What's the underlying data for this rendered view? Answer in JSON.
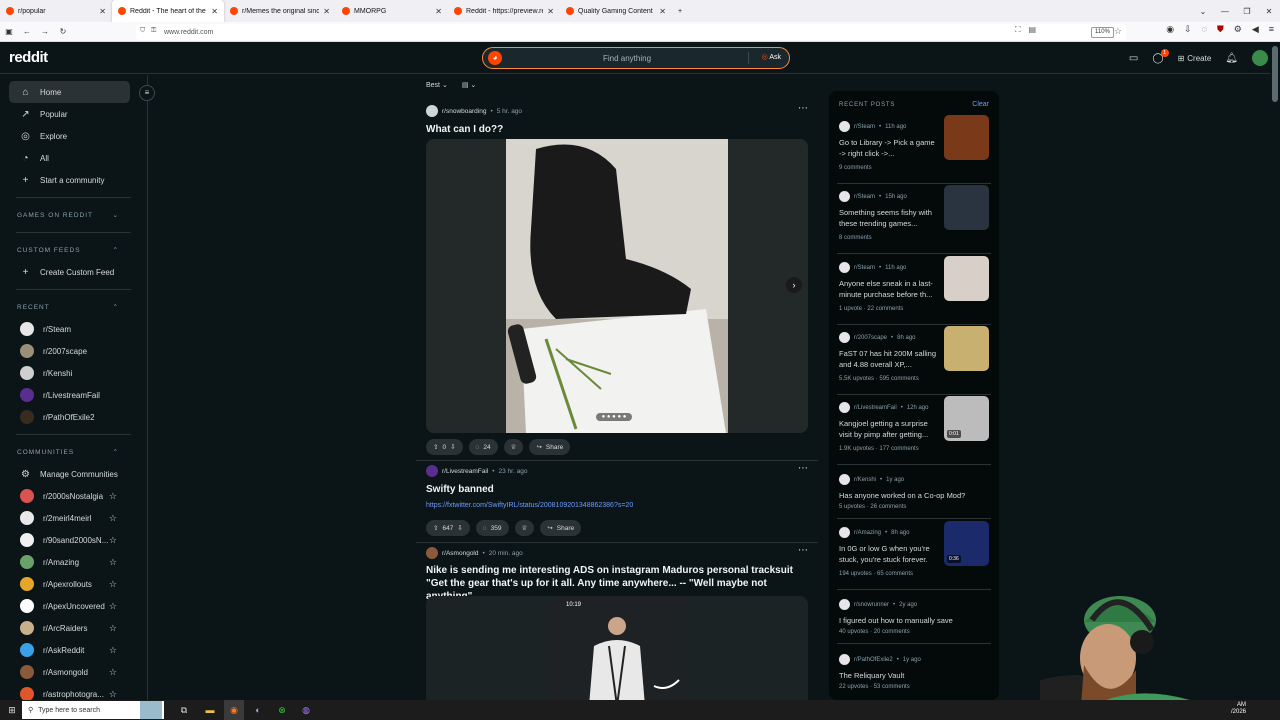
{
  "browser": {
    "tabs": [
      {
        "title": "r/popular",
        "active": false
      },
      {
        "title": "Reddit - The heart of the intern",
        "active": true
      },
      {
        "title": "r/Memes the original since 20",
        "active": false
      },
      {
        "title": "MMORPG",
        "active": false
      },
      {
        "title": "Reddit - https://preview.redd.it",
        "active": false
      },
      {
        "title": "Quality Gaming Content and Di",
        "active": false
      }
    ],
    "new_tab": "+",
    "url": "www.reddit.com",
    "zoom": "110%"
  },
  "header": {
    "logo": "reddit",
    "search_placeholder": "Find anything",
    "ask": "Ask",
    "create": "Create",
    "chat_badge": "1"
  },
  "sidebar": {
    "nav": [
      {
        "label": "Home",
        "icon": "home-icon",
        "active": true
      },
      {
        "label": "Popular",
        "icon": "popular-icon"
      },
      {
        "label": "Explore",
        "icon": "explore-icon"
      },
      {
        "label": "All",
        "icon": "all-icon"
      },
      {
        "label": "Start a community",
        "icon": "plus-icon"
      }
    ],
    "games_header": "GAMES ON REDDIT",
    "custom_feeds_header": "CUSTOM FEEDS",
    "create_custom_feed": "Create Custom Feed",
    "recent_header": "RECENT",
    "recent": [
      {
        "label": "r/Steam",
        "color": "#e6e6e6"
      },
      {
        "label": "r/2007scape",
        "color": "#9a8f77"
      },
      {
        "label": "r/Kenshi",
        "color": "#cfcfcf"
      },
      {
        "label": "r/LivestreamFail",
        "color": "#5a2d91"
      },
      {
        "label": "r/PathOfExile2",
        "color": "#3a2b20"
      }
    ],
    "communities_header": "COMMUNITIES",
    "manage": "Manage Communities",
    "communities": [
      {
        "label": "r/2000sNostalgia",
        "color": "#d9534f"
      },
      {
        "label": "r/2meirl4meirl",
        "color": "#e8e8e8"
      },
      {
        "label": "r/90sand2000sN...",
        "color": "#f0f0f0"
      },
      {
        "label": "r/Amazing",
        "color": "#6aa06a"
      },
      {
        "label": "r/Apexrollouts",
        "color": "#e4a52a"
      },
      {
        "label": "r/ApexUncovered",
        "color": "#ffffff"
      },
      {
        "label": "r/ArcRaiders",
        "color": "#c8b08a"
      },
      {
        "label": "r/AskReddit",
        "color": "#3aa0e8"
      },
      {
        "label": "r/Asmongold",
        "color": "#8a5a3a"
      },
      {
        "label": "r/astrophotogra...",
        "color": "#e0562a"
      }
    ]
  },
  "feed": {
    "sort": "Best",
    "posts": [
      {
        "sub": "r/snowboarding",
        "time": "5 hr. ago",
        "title": "What can I do??",
        "votes": "0",
        "comments": "24",
        "share": "Share"
      },
      {
        "sub": "r/LivestreamFail",
        "time": "23 hr. ago",
        "title": "Swifty banned",
        "link": "https://fxtwitter.com/SwiftyIRL/status/2008109201348862386?s=20",
        "votes": "647",
        "comments": "359",
        "share": "Share"
      },
      {
        "sub": "r/Asmongold",
        "time": "20 min. ago",
        "title": "Nike is sending me interesting ADS on instagram Maduros personal tracksuit \"Get the gear that's up for it all. Any time anywhere... -- \"Well maybe not anything\"",
        "phone_time": "10:19"
      }
    ]
  },
  "recent_posts": {
    "header": "RECENT POSTS",
    "clear": "Clear",
    "items": [
      {
        "sub": "r/Steam",
        "time": "11h ago",
        "title": "Go to Library -> Pick a game -> right click ->...",
        "stats": "9 comments",
        "thumb": "#7a3a1a"
      },
      {
        "sub": "r/Steam",
        "time": "15h ago",
        "title": "Something seems fishy with these trending games...",
        "stats": "8 comments",
        "thumb": "#2a3340"
      },
      {
        "sub": "r/Steam",
        "time": "11h ago",
        "title": "Anyone else sneak in a last-minute purchase before th...",
        "stats": "1 upvote · 22 comments",
        "thumb": "#d8d0c8"
      },
      {
        "sub": "r/2007scape",
        "time": "8h ago",
        "title": "FaST 07 has hit 200M salling and 4.88 overall XP,...",
        "stats": "5.5K upvotes · 595 comments",
        "thumb": "#c8b070"
      },
      {
        "sub": "r/LivestreamFail",
        "time": "12h ago",
        "title": "Kangjoel getting a surprise visit by pimp after getting...",
        "stats": "1.9K upvotes · 177 comments",
        "thumb": "#bcbcbc",
        "duration": "0:01"
      },
      {
        "sub": "r/Kenshi",
        "time": "1y ago",
        "title": "Has anyone worked on a Co-op Mod?",
        "stats": "5 upvotes · 26 comments"
      },
      {
        "sub": "r/Amazing",
        "time": "8h ago",
        "title": "In 0G or low G when you're stuck, you're stuck forever.",
        "stats": "194 upvotes · 65 comments",
        "thumb": "#1a2a6a",
        "duration": "0:36"
      },
      {
        "sub": "r/snowrunner",
        "time": "2y ago",
        "title": "I figured out how to manually save",
        "stats": "40 upvotes · 20 comments"
      },
      {
        "sub": "r/PathOfExile2",
        "time": "1y ago",
        "title": "The Reliquary Vault",
        "stats": "22 upvotes · 53 comments"
      }
    ]
  },
  "taskbar": {
    "search": "Type here to search",
    "time": "AM",
    "date": "/2026"
  }
}
